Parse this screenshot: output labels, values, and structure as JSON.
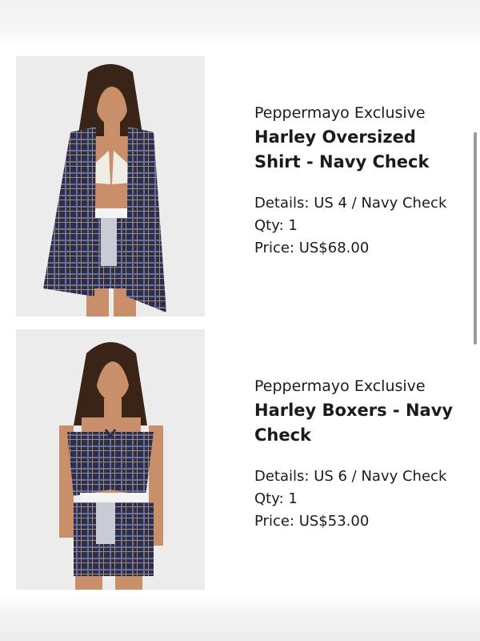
{
  "cart": {
    "items": [
      {
        "brand": "Peppermayo Exclusive",
        "name": "Harley Oversized Shirt - Navy Check",
        "details": "Details: US 4 / Navy Check",
        "qty": "Qty: 1",
        "price": "Price: US$68.00",
        "image": "harley-oversized-shirt-photo"
      },
      {
        "brand": "Peppermayo Exclusive",
        "name": "Harley Boxers - Navy Check",
        "details": "Details: US 6 / Navy Check",
        "qty": "Qty: 1",
        "price": "Price: US$53.00",
        "image": "harley-boxers-photo"
      }
    ]
  },
  "colors": {
    "text": "#1b1b1b",
    "photo_bg": "#ececec",
    "plaid_navy": "#2a2f52",
    "skin": "#c98f6a",
    "hair": "#3a2418"
  }
}
